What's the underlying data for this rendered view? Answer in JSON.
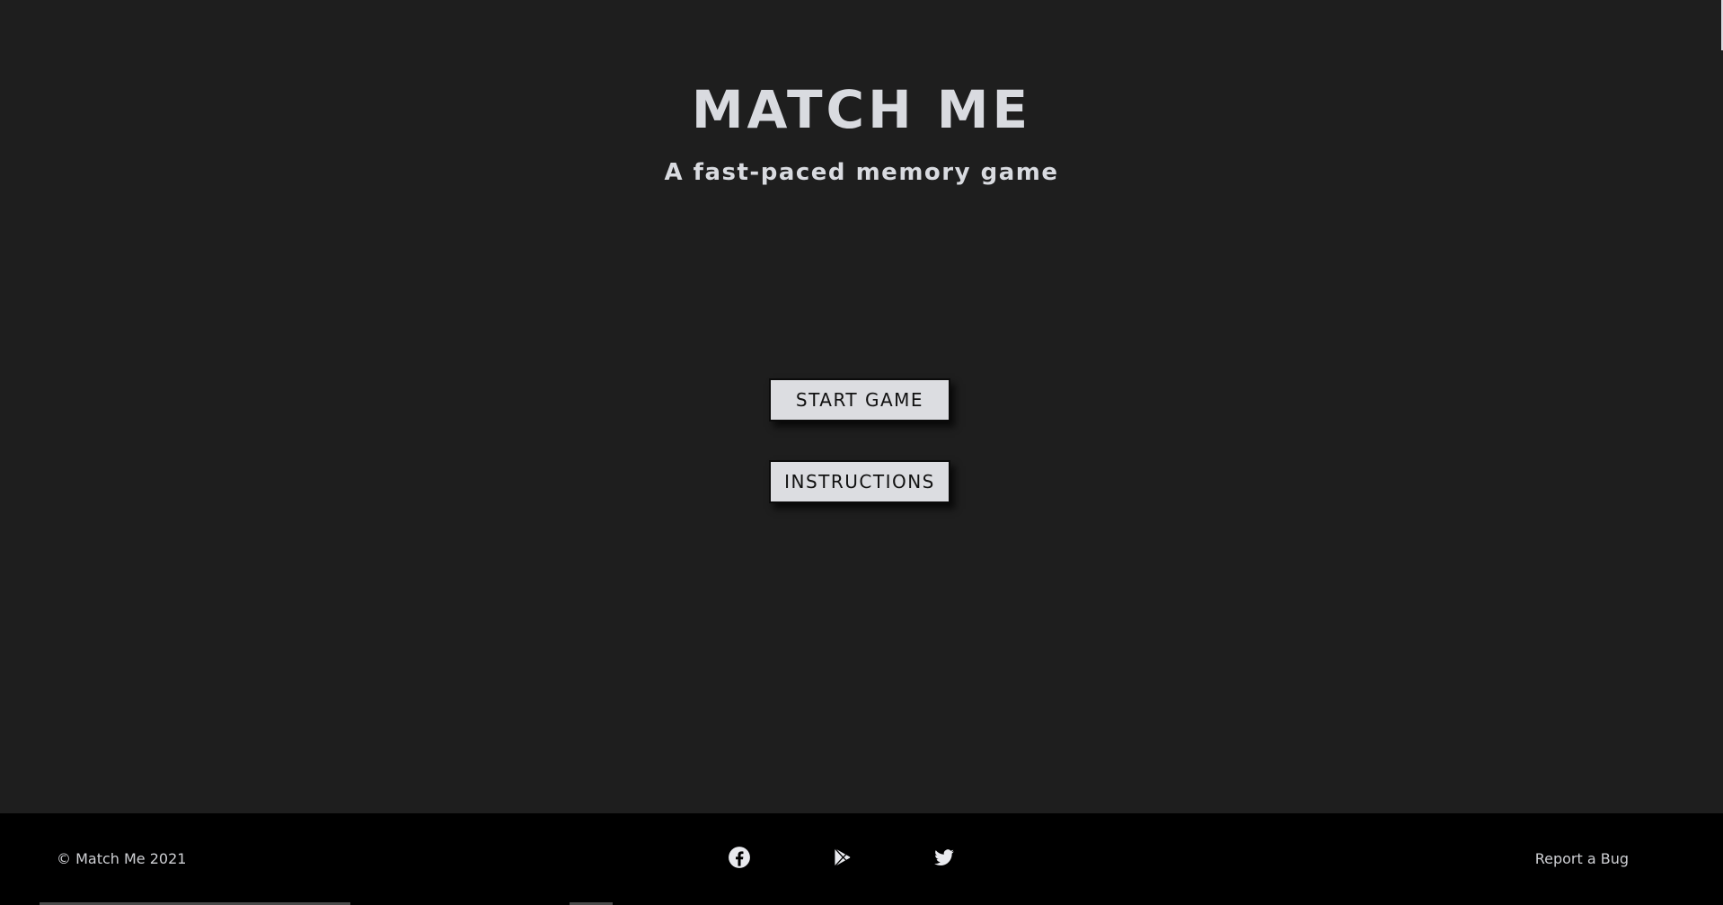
{
  "app": {
    "title": "MATCH ME",
    "subtitle": "A fast-paced memory game"
  },
  "menu": {
    "start_label": "START GAME",
    "instructions_label": "INSTRUCTIONS"
  },
  "footer": {
    "copyright": "© Match Me 2021",
    "social": [
      {
        "icon": "facebook-icon"
      },
      {
        "icon": "google-play-icon"
      },
      {
        "icon": "twitter-icon"
      }
    ],
    "report_label": "Report a Bug"
  },
  "colors": {
    "background": "#1e1e1e",
    "footer": "#000000",
    "text": "#d9dbe0",
    "button": "#dcdde1"
  }
}
